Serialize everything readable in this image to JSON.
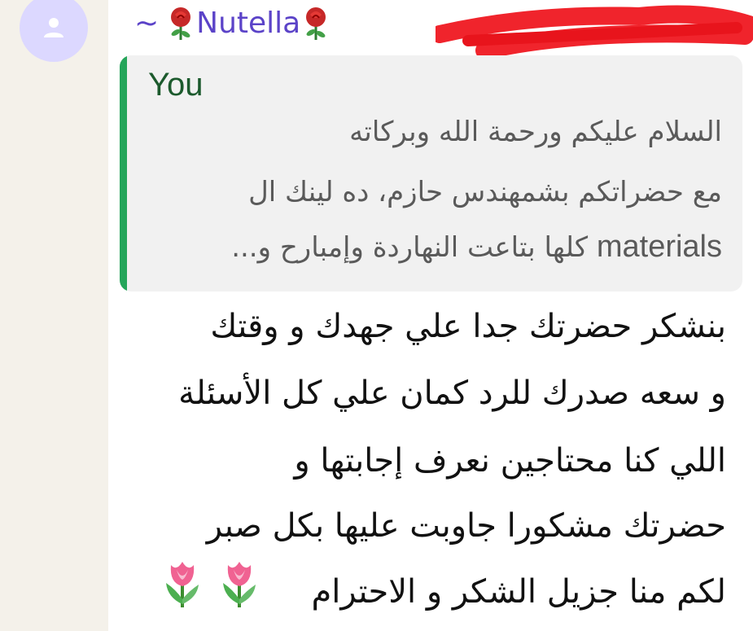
{
  "sender": {
    "prefix": "~",
    "name": "Nutella",
    "decoration_icon": "rose-icon",
    "color": "#5b43c8"
  },
  "quote": {
    "author": "You",
    "lines": [
      "السلام عليكم ورحمة الله وبركاته",
      "مع حضراتكم بشمهندس حازم، ده لينك ال",
      "كلها بتاعت النهاردة وإمبارح و..."
    ],
    "latin_word": "materials",
    "accent_color": "#25a55a"
  },
  "message": {
    "lines": [
      "بنشكر حضرتك جدا علي جهدك و وقتك",
      "و سعه صدرك للرد كمان علي كل الأسئلة",
      "اللي كنا محتاجين نعرف إجابتها و",
      "حضرتك مشكورا جاوبت عليها بكل صبر",
      "لكم منا جزيل الشكر و الاحترام"
    ],
    "emoji_icon": "tulip-icon"
  }
}
